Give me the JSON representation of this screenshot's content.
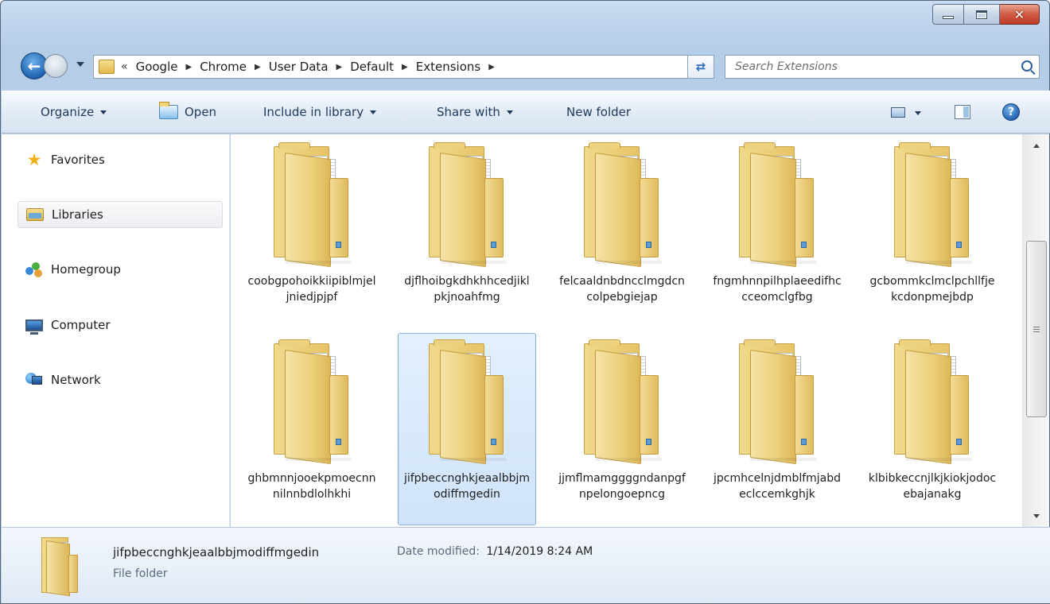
{
  "window": {
    "controls": {
      "close_glyph": "✕"
    }
  },
  "navigation": {
    "breadcrumb_overflow": "«",
    "breadcrumb": [
      "Google",
      "Chrome",
      "User Data",
      "Default",
      "Extensions"
    ],
    "search_placeholder": "Search Extensions"
  },
  "toolbar": {
    "organize": "Organize",
    "open": "Open",
    "include_in_library": "Include in library",
    "share_with": "Share with",
    "new_folder": "New folder",
    "help_glyph": "?"
  },
  "sidebar": {
    "items": [
      {
        "label": "Favorites",
        "icon": "star-icon"
      },
      {
        "label": "Libraries",
        "icon": "libraries-icon",
        "selected": true
      },
      {
        "label": "Homegroup",
        "icon": "homegroup-icon"
      },
      {
        "label": "Computer",
        "icon": "computer-icon"
      },
      {
        "label": "Network",
        "icon": "network-icon"
      }
    ]
  },
  "folders": [
    {
      "name": "coobgpohoikkiipiblmjeljniedjpjpf",
      "selected": false
    },
    {
      "name": "djflhoibgkdhkhhcedjiklpkjnoahfmg",
      "selected": false
    },
    {
      "name": "felcaaldnbdncclmgdcncolpebgiejap",
      "selected": false
    },
    {
      "name": "fngmhnnpilhplaeedifhccceomclgfbg",
      "selected": false
    },
    {
      "name": "gcbommkclmclpchllfjekcdonpmejbdp",
      "selected": false
    },
    {
      "name": "ghbmnnjooekpmoecnnnilnnbdlolhkhi",
      "selected": false
    },
    {
      "name": "jifpbeccnghkjeaalbbjmodiffmgedin",
      "selected": true
    },
    {
      "name": "jjmflmamggggndanpgfnpelongoepncg",
      "selected": false
    },
    {
      "name": "jpcmhcelnjdmblfmjabdeclccemkghjk",
      "selected": false
    },
    {
      "name": "klbibkeccnjlkjkiokjodocebajanakg",
      "selected": false
    }
  ],
  "details": {
    "name": "jifpbeccnghkjeaalbbjmodiffmgedin",
    "date_modified_label": "Date modified:",
    "date_modified": "1/14/2019 8:24 AM",
    "type": "File folder"
  }
}
